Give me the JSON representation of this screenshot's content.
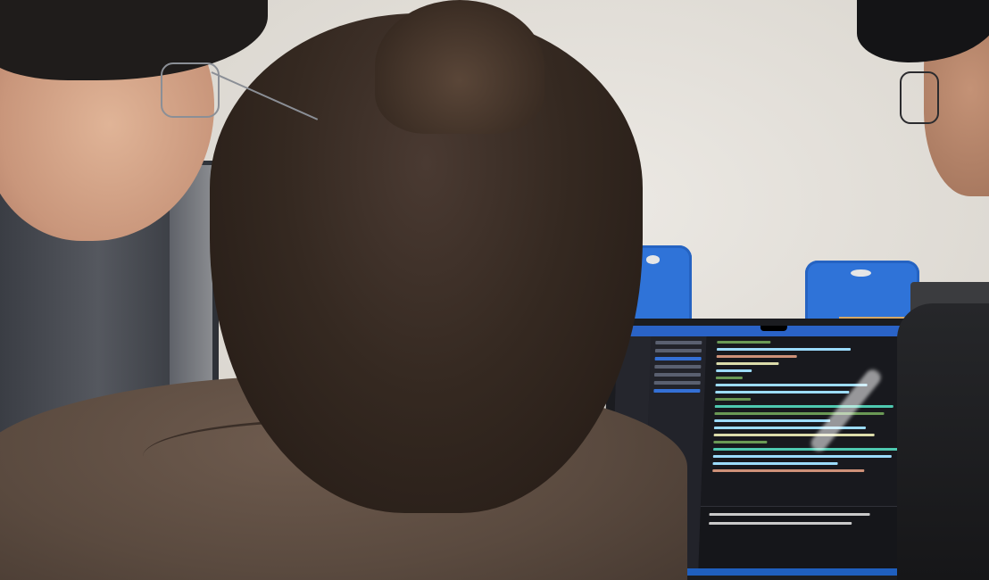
{
  "scene": {
    "description_alt": "",
    "screen_app": "code-editor",
    "screen_theme": "dark"
  },
  "colors": {
    "wall": "#e6e3dd",
    "chair": "#2f73d8",
    "table": "#d7a866",
    "hoodie": "#5a4a3f",
    "hair": "#352921",
    "editor_bg": "#18191e",
    "statusbar": "#1f5fbf"
  },
  "code_lines": [
    {
      "color": "#6a9955",
      "w": 60
    },
    {
      "color": "#9cdcfe",
      "w": 150
    },
    {
      "color": "#ce9178",
      "w": 90
    },
    {
      "color": "#dcdcaa",
      "w": 70
    },
    {
      "color": "#9cdcfe",
      "w": 40
    },
    {
      "color": "#6a9955",
      "w": 30
    },
    {
      "color": "#9cdcfe",
      "w": 170
    },
    {
      "color": "#9cdcfe",
      "w": 150
    },
    {
      "color": "#6a9955",
      "w": 40
    },
    {
      "color": "#4ec9b0",
      "w": 200
    },
    {
      "color": "#6a9955",
      "w": 190
    },
    {
      "color": "#9cdcfe",
      "w": 130
    },
    {
      "color": "#9cdcfe",
      "w": 170
    },
    {
      "color": "#dcdcaa",
      "w": 180
    },
    {
      "color": "#6a9955",
      "w": 60
    },
    {
      "color": "#4ec9b0",
      "w": 210
    },
    {
      "color": "#9cdcfe",
      "w": 200
    },
    {
      "color": "#9cdcfe",
      "w": 140
    },
    {
      "color": "#ce9178",
      "w": 170
    }
  ]
}
